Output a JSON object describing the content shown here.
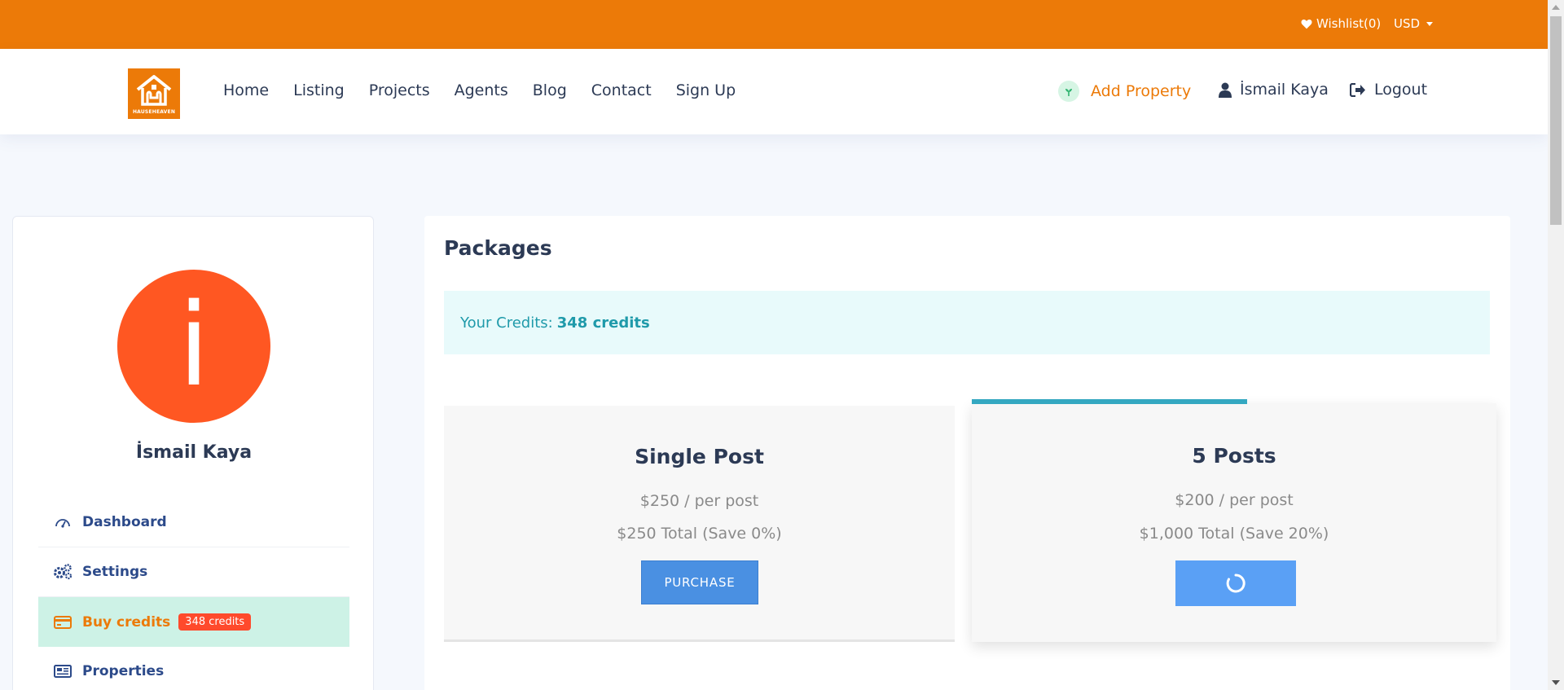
{
  "topbar": {
    "wishlist_label": "Wishlist(0)",
    "currency_label": "USD"
  },
  "header": {
    "logo_text": "HAUSEHEAVEN",
    "nav": [
      "Home",
      "Listing",
      "Projects",
      "Agents",
      "Blog",
      "Contact",
      "Sign Up"
    ],
    "add_property_label": "Add Property",
    "user_label": "İsmail Kaya",
    "logout_label": "Logout"
  },
  "sidebar": {
    "avatar_letter": "i",
    "name": "İsmail Kaya",
    "menu": [
      {
        "label": "Dashboard",
        "icon": "dashboard-icon"
      },
      {
        "label": "Settings",
        "icon": "gears-icon"
      },
      {
        "label": "Buy credits",
        "icon": "credit-card-icon",
        "badge": "348 credits",
        "active": true
      },
      {
        "label": "Properties",
        "icon": "newspaper-icon"
      }
    ]
  },
  "main": {
    "title": "Packages",
    "credits_label": "Your Credits:",
    "credits_value": "348 credits",
    "packages": [
      {
        "title": "Single Post",
        "price": "$250 / per post",
        "total": "$250 Total (Save 0%)",
        "button_label": "PURCHASE",
        "state": "idle"
      },
      {
        "title": "5 Posts",
        "price": "$200 / per post",
        "total": "$1,000 Total (Save 20%)",
        "button_label": "",
        "state": "loading"
      }
    ]
  },
  "colors": {
    "brand_orange": "#ec7a08",
    "avatar_bg": "#ff5722",
    "button_blue": "#4a90e2",
    "credits_teal": "#1f9aaa",
    "highlight_line": "#34a8c1",
    "active_menu_bg": "#cdf2e6"
  }
}
